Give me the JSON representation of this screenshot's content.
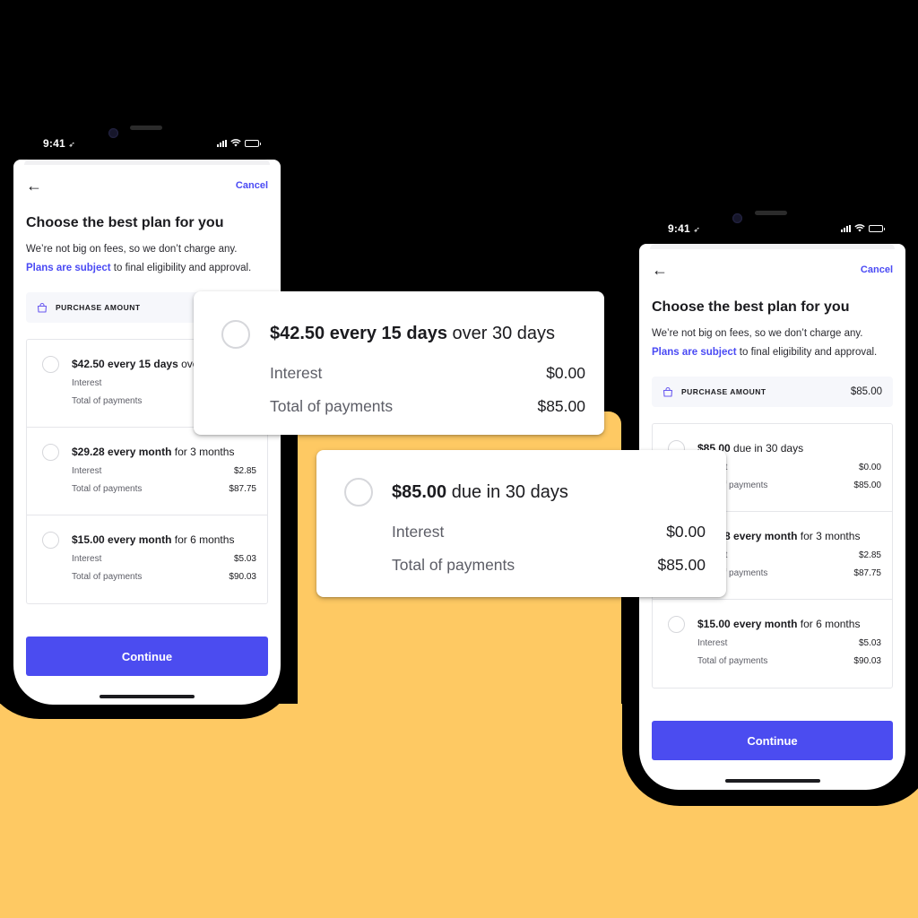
{
  "colors": {
    "accent": "#4b4cf0",
    "background_dark": "#000000",
    "background_yellow": "#fec963"
  },
  "status_bar": {
    "time": "9:41",
    "location_icon": "location-arrow-icon",
    "signal_icon": "cellular-signal-icon",
    "wifi_icon": "wifi-icon",
    "battery_icon": "battery-icon"
  },
  "screen": {
    "back_icon": "arrow-left-icon",
    "cancel_label": "Cancel",
    "title": "Choose the best plan for you",
    "subtitle_line1": "We’re not big on fees, so we don’t charge any.",
    "subtitle_link": "Plans are subject",
    "subtitle_rest": " to final eligibility and approval.",
    "purchase_icon": "shopping-bag-icon",
    "purchase_label": "PURCHASE AMOUNT",
    "purchase_amount": "$85.00",
    "continue_label": "Continue"
  },
  "left_phone": {
    "plans": [
      {
        "bold": "$42.50 every 15 days",
        "rest": " over 30 days",
        "interest_label": "Interest",
        "interest": "$0.00",
        "total_label": "Total of payments",
        "total": "$85.00"
      },
      {
        "bold": "$29.28 every month",
        "rest": " for 3 months",
        "interest_label": "Interest",
        "interest": "$2.85",
        "total_label": "Total of payments",
        "total": "$87.75"
      },
      {
        "bold": "$15.00 every month",
        "rest": " for 6 months",
        "interest_label": "Interest",
        "interest": "$5.03",
        "total_label": "Total of payments",
        "total": "$90.03"
      }
    ]
  },
  "right_phone": {
    "plans": [
      {
        "bold": "$85.00",
        "rest": " due in 30 days",
        "interest_label": "Interest",
        "interest": "$0.00",
        "total_label": "Total of payments",
        "total": "$85.00"
      },
      {
        "bold": "$29.28 every month",
        "rest": " for 3 months",
        "interest_label": "Interest",
        "interest": "$2.85",
        "total_label": "Total of payments",
        "total": "$87.75"
      },
      {
        "bold": "$15.00 every month",
        "rest": " for 6 months",
        "interest_label": "Interest",
        "interest": "$5.03",
        "total_label": "Total of payments",
        "total": "$90.03"
      }
    ]
  },
  "zoom_cards": [
    {
      "bold": "$42.50 every 15 days",
      "rest": " over 30 days",
      "interest_label": "Interest",
      "interest": "$0.00",
      "total_label": "Total of payments",
      "total": "$85.00"
    },
    {
      "bold": "$85.00",
      "rest": " due in 30 days",
      "interest_label": "Interest",
      "interest": "$0.00",
      "total_label": "Total of payments",
      "total": "$85.00"
    }
  ]
}
